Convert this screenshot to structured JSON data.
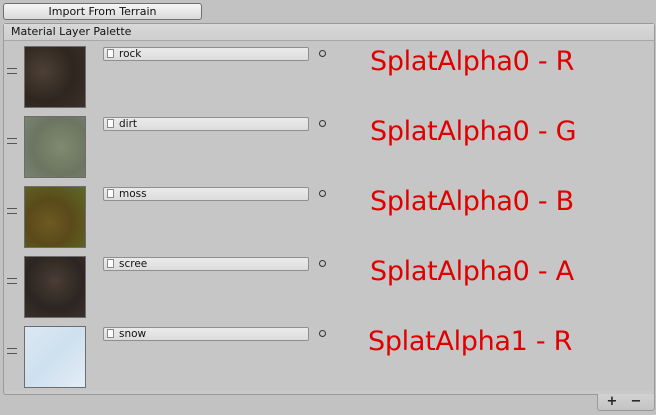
{
  "toolbar": {
    "import_label": "Import From Terrain"
  },
  "palette": {
    "title": "Material Layer Palette",
    "layers": [
      {
        "name": "rock",
        "channel": "SplatAlpha0 - R",
        "thumb": "rock"
      },
      {
        "name": "dirt",
        "channel": "SplatAlpha0 - G",
        "thumb": "dirt"
      },
      {
        "name": "moss",
        "channel": "SplatAlpha0 - B",
        "thumb": "moss"
      },
      {
        "name": "scree",
        "channel": "SplatAlpha0 - A",
        "thumb": "scree"
      },
      {
        "name": "snow",
        "channel": "SplatAlpha1 - R",
        "thumb": "snow"
      }
    ]
  },
  "footer": {
    "add_label": "+",
    "remove_label": "−"
  },
  "colors": {
    "annotation": "#e00000",
    "background": "#c2c2c2"
  }
}
